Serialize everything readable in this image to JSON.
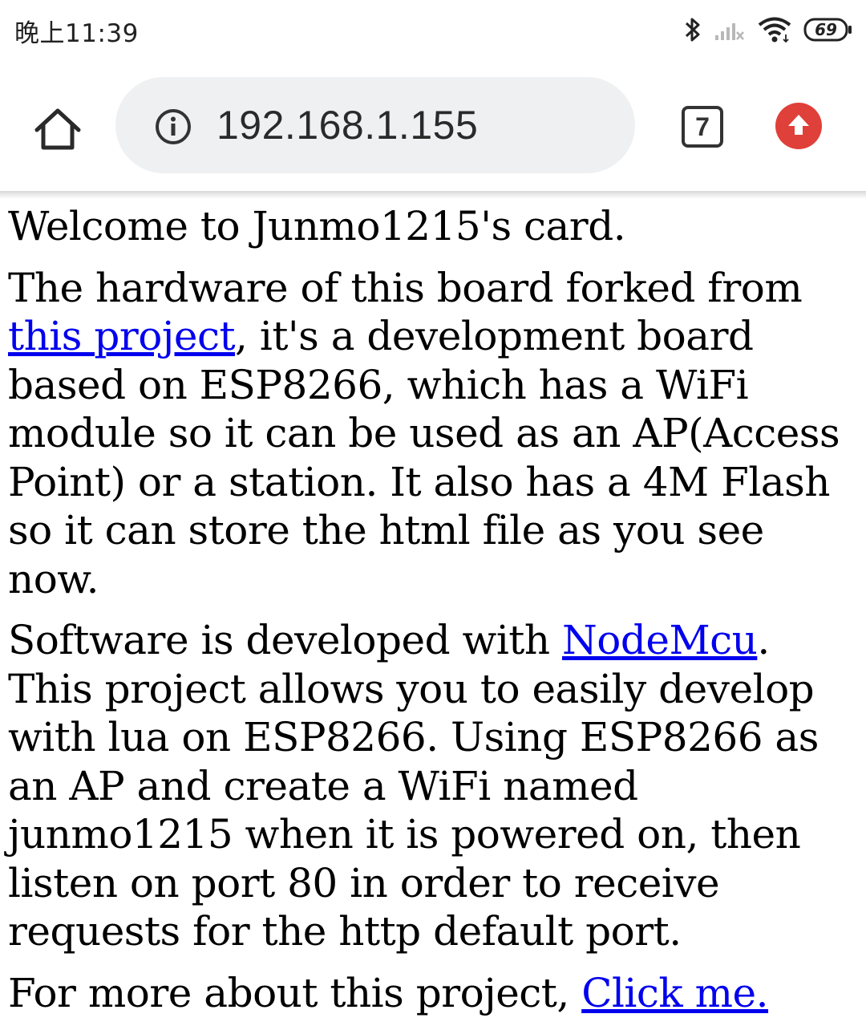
{
  "status_bar": {
    "time": "晚上11:39",
    "battery": "69",
    "icons": [
      "bluetooth-icon",
      "signal-icon",
      "wifi-icon",
      "battery-icon"
    ]
  },
  "browser": {
    "url": "192.168.1.155",
    "tab_count": "7",
    "icons": [
      "home-icon",
      "info-icon",
      "tab-switcher-icon",
      "update-icon"
    ],
    "colors": {
      "omnibox_bg": "#eef0f2",
      "update_badge": "#e0403a",
      "link": "#0000ee"
    }
  },
  "page": {
    "p1": "Welcome to Junmo1215's card.",
    "p2": {
      "before": "The hardware of this board forked from ",
      "link": "this project",
      "after": ", it's a development board based on ESP8266, which has a WiFi module so it can be used as an AP(Access Point) or a station. It also has a 4M Flash so it can store the html file as you see now."
    },
    "p3": {
      "before": "Software is developed with ",
      "link": "NodeMcu",
      "after": ". This project allows you to easily develop with lua on ESP8266. Using ESP8266 as an AP and create a WiFi named junmo1215 when it is powered on, then listen on port 80 in order to receive requests for the http default port."
    },
    "p4": {
      "before": "For more about this project, ",
      "link": "Click me."
    }
  }
}
